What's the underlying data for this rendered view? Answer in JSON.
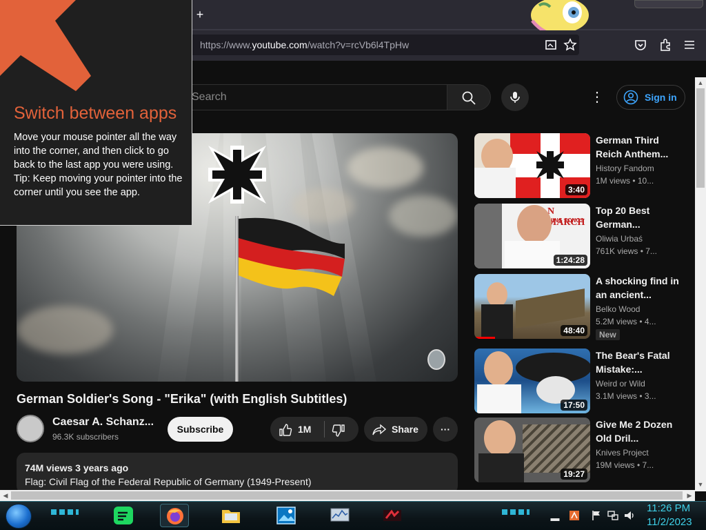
{
  "browser": {
    "new_tab_label": "+",
    "url_prefix": "https://www.",
    "url_host": "youtube.com",
    "url_path": "/watch?v=rcVb6l4TpHw"
  },
  "youtube": {
    "search_placeholder": "Search",
    "more_label": "⋮",
    "signin_label": "Sign in",
    "video": {
      "title": "German Soldier's Song - \"Erika\" (with English Subtitles)",
      "channel": "Caesar A. Schanz...",
      "subscribers": "96.3K subscribers",
      "subscribe_label": "Subscribe",
      "likes": "1M",
      "share_label": "Share",
      "more_label": "···",
      "views_age": "74M views  3 years ago",
      "description": "Flag: Civil Flag of the Federal Republic of Germany (1949-Present)"
    },
    "recommended": [
      {
        "title": "German Third Reich Anthem...",
        "channel": "History Fandom",
        "views": "1M views  • 10...",
        "duration": "3:40"
      },
      {
        "title": "Top 20 Best German...",
        "channel": "Oliwia Urbaś",
        "views": "761K views  • 7...",
        "duration": "1:24:28",
        "thumb_text": "N MARCH",
        "thumb_subtext": "CHING SONGS"
      },
      {
        "title": "A shocking find in an ancient...",
        "channel": "Belko Wood",
        "views": "5.2M views  • 4...",
        "duration": "48:40",
        "badge": "New"
      },
      {
        "title": "The Bear's Fatal Mistake:...",
        "channel": "Weird or Wild",
        "views": "3.1M views  • 3...",
        "duration": "17:50"
      },
      {
        "title": "Give Me 2 Dozen Old Dril...",
        "channel": "Knives Project",
        "views": "19M views  • 7...",
        "duration": "19:27"
      }
    ]
  },
  "tip": {
    "title": "Switch between apps",
    "body_line1": "Move your mouse pointer all the way into the corner, and then click to go back to the last app you were using.",
    "body_line2": "Tip: Keep moving your pointer into the corner until you see the app."
  },
  "taskbar": {
    "time": "11:26 PM",
    "date": "11/2/2023"
  },
  "colors": {
    "tip_accent": "#e2623a",
    "youtube_link": "#3ea6ff",
    "clock": "#3fd0e8",
    "background": "#0f0f0f"
  },
  "icons": [
    "tip-arrow-icon",
    "new-tab-icon",
    "reader-view-icon",
    "bookmark-star-icon",
    "pocket-icon",
    "extensions-icon",
    "menu-icon",
    "search-icon",
    "microphone-icon",
    "user-icon",
    "thumbs-up-icon",
    "thumbs-down-icon",
    "share-icon",
    "start-orb-icon",
    "spotify-icon",
    "firefox-icon",
    "file-explorer-icon",
    "photos-icon",
    "flag-icon",
    "network-icon",
    "volume-icon"
  ]
}
